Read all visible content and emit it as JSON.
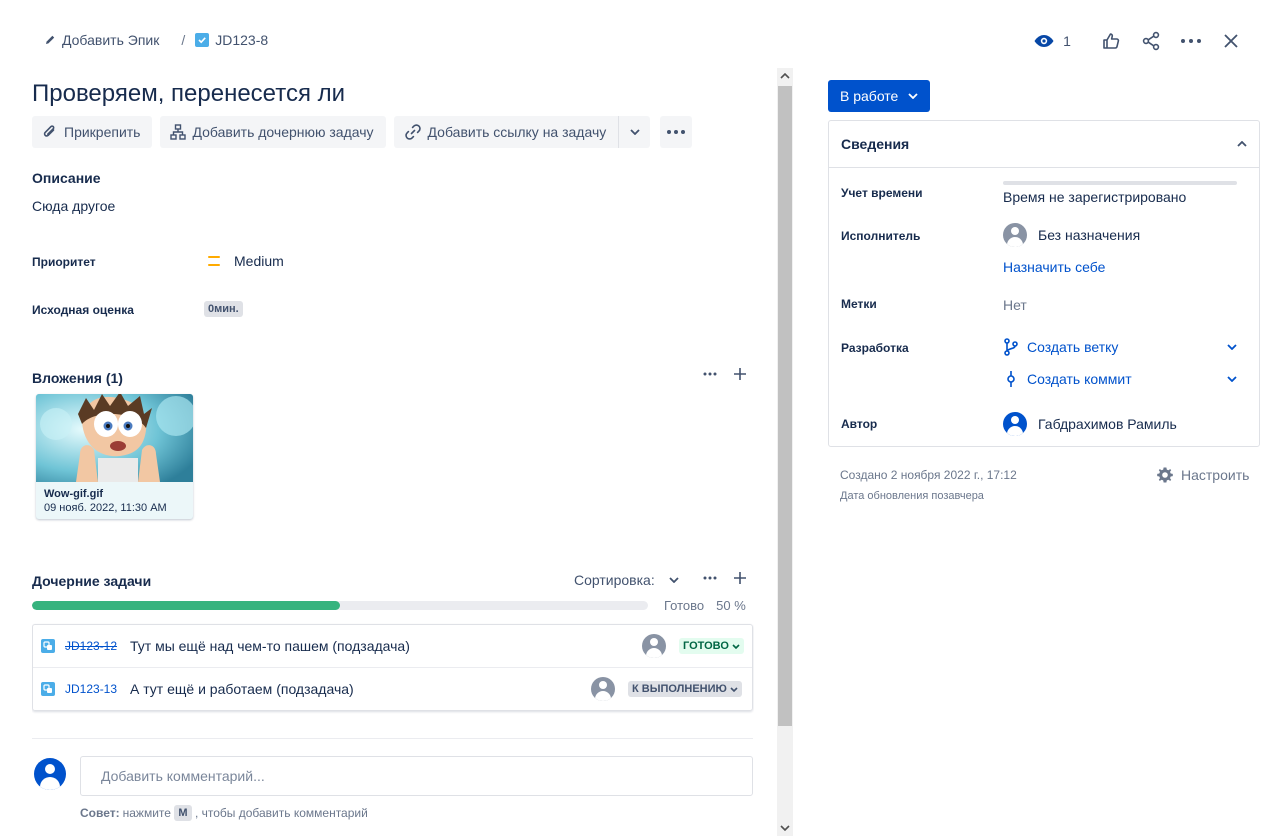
{
  "breadcrumb": {
    "epic_label": "Добавить Эпик",
    "issue_key": "JD123-8"
  },
  "header_actions": {
    "watch_count": "1"
  },
  "issue": {
    "title": "Проверяем, перенесется ли"
  },
  "toolbar": {
    "attach_label": "Прикрепить",
    "add_child_label": "Добавить дочернюю задачу",
    "link_issue_label": "Добавить ссылку на задачу"
  },
  "description": {
    "heading": "Описание",
    "value": "Сюда другое"
  },
  "fields": {
    "priority_label": "Приоритет",
    "priority_value": "Medium",
    "priority_color": "#ffab00",
    "estimate_label": "Исходная оценка",
    "estimate_value": "0мин."
  },
  "attachments": {
    "heading": "Вложения (1)",
    "items": [
      {
        "name": "Wow-gif.gif",
        "date": "09 нояб. 2022, 11:30 AM"
      }
    ]
  },
  "child_issues": {
    "heading": "Дочерние задачи",
    "sort_label": "Сортировка:",
    "progress_label": "Готово",
    "progress_percent": "50 %",
    "progress_fraction": 0.5,
    "progress_color": "#36b37e",
    "items": [
      {
        "key": "JD123-12",
        "summary": "Тут мы ещё над чем-то пашем (подзадача)",
        "status": "ГОТОВО",
        "done": true
      },
      {
        "key": "JD123-13",
        "summary": "А тут ещё и работаем (подзадача)",
        "status": "К ВЫПОЛНЕНИЮ",
        "done": false
      }
    ]
  },
  "comment": {
    "placeholder": "Добавить комментарий...",
    "tip_prefix": "Совет:",
    "tip_press": "нажмите",
    "tip_key": "M",
    "tip_suffix": ", чтобы добавить комментарий"
  },
  "status_button": {
    "label": "В работе",
    "color": "#0052cc"
  },
  "details": {
    "heading": "Сведения",
    "time_tracking_label": "Учет времени",
    "time_tracking_value": "Время не зарегистрировано",
    "assignee_label": "Исполнитель",
    "assignee_value": "Без назначения",
    "assign_to_me": "Назначить себе",
    "labels_label": "Метки",
    "labels_value": "Нет",
    "development_label": "Разработка",
    "create_branch": "Создать ветку",
    "create_commit": "Создать коммит",
    "reporter_label": "Автор",
    "reporter_value": "Габдрахимов Рамиль"
  },
  "meta": {
    "created": "Создано 2 ноября 2022 г., 17:12",
    "updated": "Дата обновления позавчера",
    "configure_label": "Настроить"
  }
}
